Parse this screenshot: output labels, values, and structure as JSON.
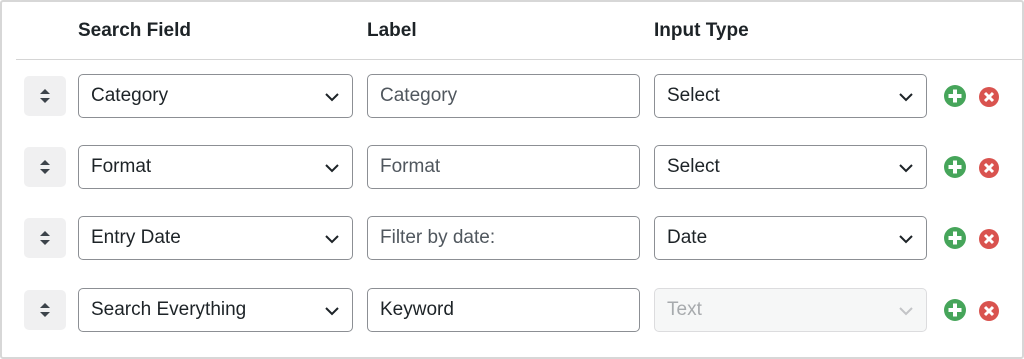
{
  "header": {
    "search_field": "Search Field",
    "label": "Label",
    "input_type": "Input Type"
  },
  "rows": [
    {
      "search_field": "Category",
      "label_value": "",
      "label_placeholder": "Category",
      "input_type": "Select",
      "input_type_disabled": false
    },
    {
      "search_field": "Format",
      "label_value": "",
      "label_placeholder": "Format",
      "input_type": "Select",
      "input_type_disabled": false
    },
    {
      "search_field": "Entry Date",
      "label_value": "",
      "label_placeholder": "Filter by date:",
      "input_type": "Date",
      "input_type_disabled": false
    },
    {
      "search_field": "Search Everything",
      "label_value": "Keyword",
      "label_placeholder": "",
      "input_type": "Text",
      "input_type_disabled": true
    }
  ],
  "icons": {
    "drag": "sort-handle-icon",
    "add": "plus-circle-icon",
    "remove": "x-circle-icon"
  },
  "colors": {
    "add": "#46a55a",
    "remove": "#d9534f",
    "border": "#8c8f94",
    "handle_bg": "#f0f0f1"
  }
}
